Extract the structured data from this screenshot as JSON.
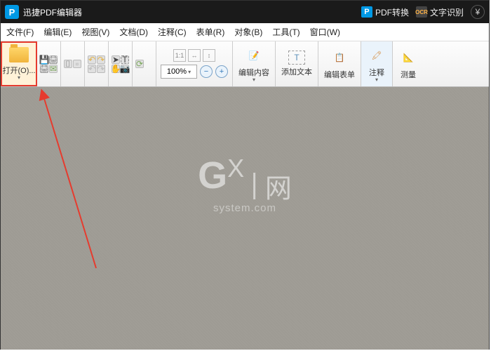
{
  "titlebar": {
    "app_title": "迅捷PDF编辑器",
    "btn_pdf_convert": "PDF转换",
    "btn_ocr": "文字识别"
  },
  "menubar": {
    "items": [
      "文件(F)",
      "编辑(E)",
      "视图(V)",
      "文档(D)",
      "注释(C)",
      "表单(R)",
      "对象(B)",
      "工具(T)",
      "窗口(W)"
    ]
  },
  "toolbar": {
    "open_label": "打开(O)...",
    "zoom_value": "100%",
    "edit_content": "编辑内容",
    "add_text": "添加文本",
    "edit_form": "编辑表单",
    "annotate": "注释",
    "measure": "测量"
  },
  "watermark": {
    "g": "G",
    "x": "X",
    "cn": "网",
    "sub": "system.com"
  }
}
